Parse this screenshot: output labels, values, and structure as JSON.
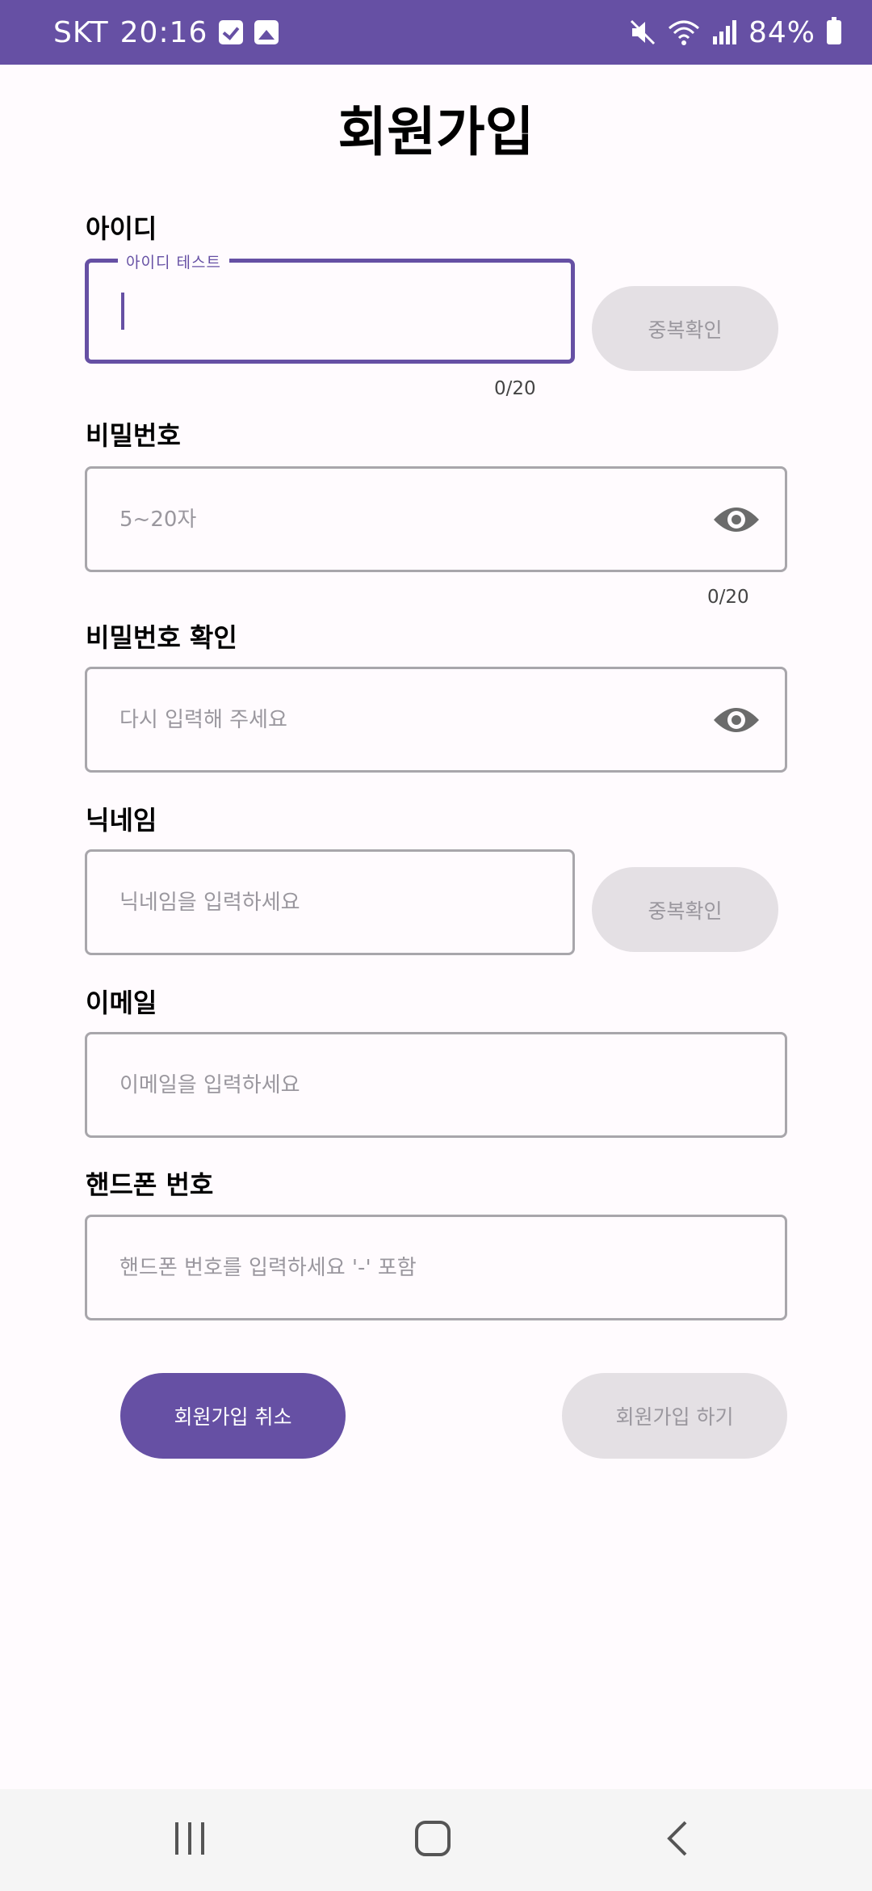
{
  "status_bar": {
    "carrier": "SKT",
    "time": "20:16",
    "battery": "84%",
    "icons": [
      "checkbox-icon",
      "image-icon",
      "mute-icon",
      "wifi-icon",
      "signal-icon",
      "battery-icon"
    ]
  },
  "title": "회원가입",
  "fields": {
    "id": {
      "label": "아이디",
      "float_label": "아이디 테스트",
      "value": "",
      "counter": "0/20",
      "check_button": "중복확인"
    },
    "password": {
      "label": "비밀번호",
      "placeholder": "5~20자",
      "counter": "0/20"
    },
    "password_confirm": {
      "label": "비밀번호 확인",
      "placeholder": "다시 입력해 주세요"
    },
    "nickname": {
      "label": "닉네임",
      "placeholder": "닉네임을 입력하세요",
      "check_button": "중복확인"
    },
    "email": {
      "label": "이메일",
      "placeholder": "이메일을 입력하세요"
    },
    "phone": {
      "label": "핸드폰 번호",
      "placeholder": "핸드폰 번호를 입력하세요 '-' 포함"
    }
  },
  "actions": {
    "cancel": "회원가입 취소",
    "submit": "회원가입 하기"
  },
  "colors": {
    "accent": "#6650a4",
    "disabled_bg": "#e4e0e4",
    "disabled_text": "#9a979e",
    "border": "#a8a6ab"
  }
}
